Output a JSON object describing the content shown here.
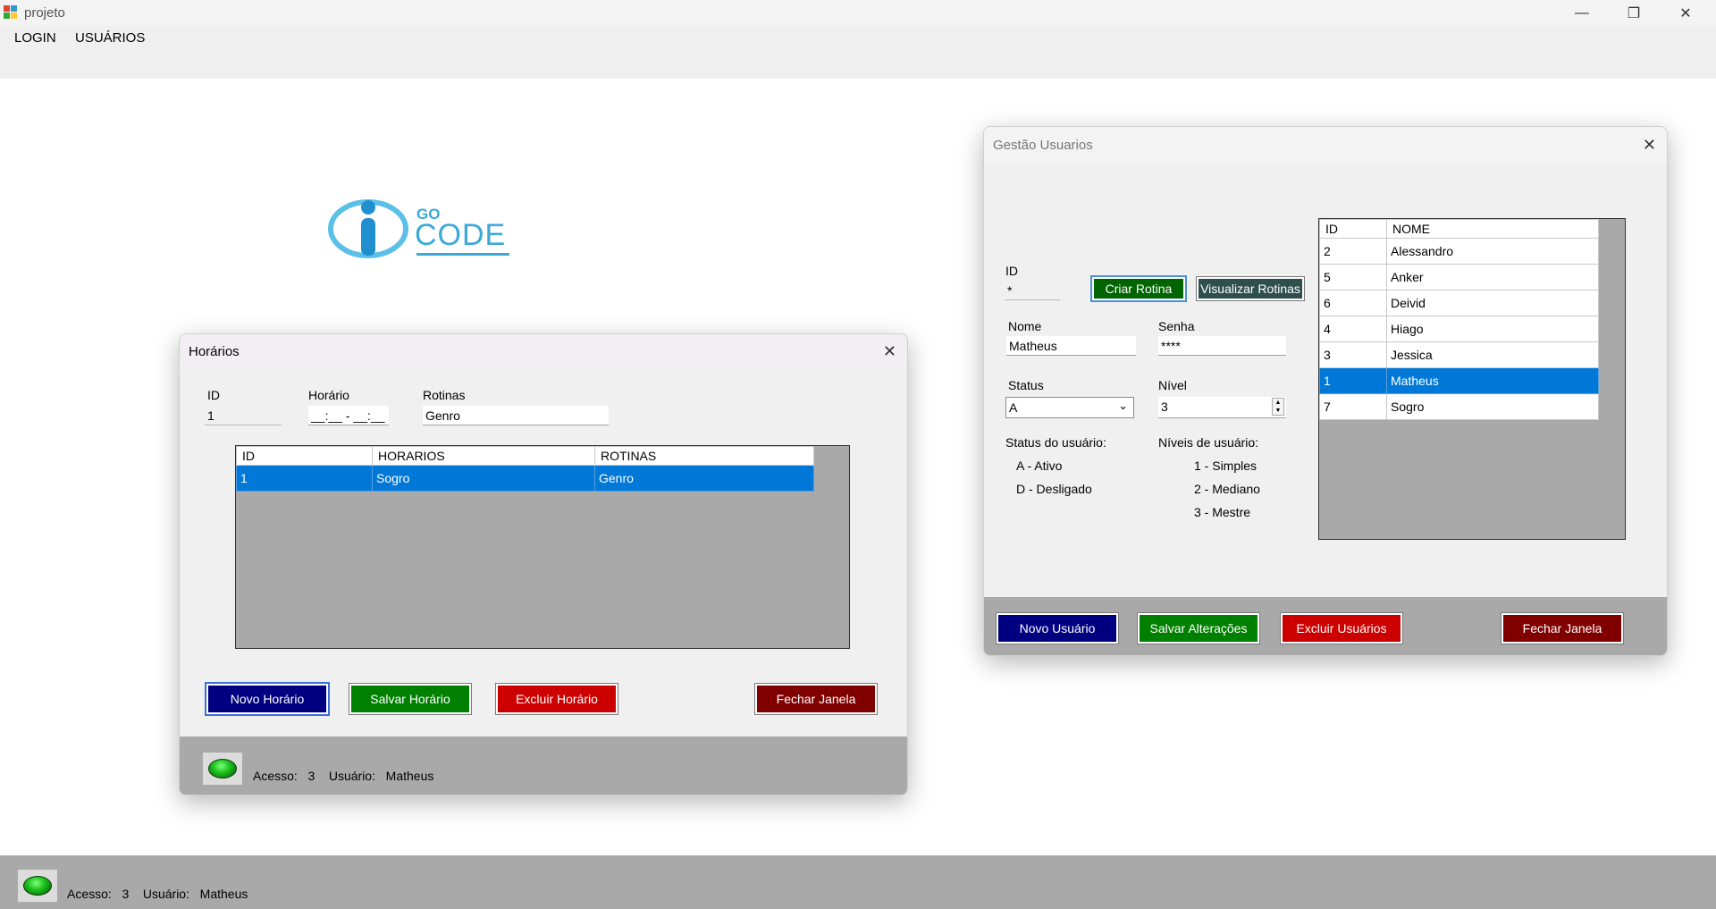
{
  "window": {
    "title": "projeto"
  },
  "menu": {
    "items": [
      "LOGIN",
      "USUÁRIOS"
    ]
  },
  "logo": {
    "small": "GO",
    "big": "CODE"
  },
  "status_main": {
    "access_label": "Acesso:",
    "access_value": "3",
    "user_label": "Usuário:",
    "user_value": "Matheus"
  },
  "horarios": {
    "title": "Horários",
    "id_label": "ID",
    "id_value": "1",
    "horario_label": "Horário",
    "horario_value": "__:__ - __:__",
    "rotinas_label": "Rotinas",
    "rotinas_value": "Genro",
    "grid": {
      "columns": [
        "ID",
        "HORARIOS",
        "ROTINAS"
      ],
      "rows": [
        [
          "1",
          "Sogro",
          "Genro"
        ]
      ]
    },
    "buttons": {
      "novo": "Novo Horário",
      "salvar": "Salvar Horário",
      "excluir": "Excluir Horário",
      "fechar": "Fechar Janela"
    },
    "status": {
      "access_label": "Acesso:",
      "access_value": "3",
      "user_label": "Usuário:",
      "user_value": "Matheus"
    }
  },
  "usuarios": {
    "title": "Gestão Usuarios",
    "id_label": "ID",
    "id_value": "*",
    "criar_rotina": "Criar Rotina",
    "visualizar_rotinas": "Visualizar Rotinas",
    "nome_label": "Nome",
    "nome_value": "Matheus",
    "senha_label": "Senha",
    "senha_value": "****",
    "status_label": "Status",
    "status_value": "A",
    "nivel_label": "Nível",
    "nivel_value": "3",
    "status_help_title": "Status do usuário:",
    "status_help": [
      "A - Ativo",
      "D - Desligado"
    ],
    "nivel_help_title": "Níveis de usuário:",
    "nivel_help": [
      "1 - Simples",
      "2 - Mediano",
      "3 - Mestre"
    ],
    "grid": {
      "columns": [
        "ID",
        "NOME"
      ],
      "rows": [
        [
          "2",
          "Alessandro"
        ],
        [
          "5",
          "Anker"
        ],
        [
          "6",
          "Deivid"
        ],
        [
          "4",
          "Hiago"
        ],
        [
          "3",
          "Jessica"
        ],
        [
          "1",
          "Matheus"
        ],
        [
          "7",
          "Sogro"
        ]
      ],
      "selected_row": 5
    },
    "buttons": {
      "novo": "Novo Usuário",
      "salvar": "Salvar Alterações",
      "excluir": "Excluir Usuários",
      "fechar": "Fechar Janela"
    }
  },
  "colors": {
    "selection": "#0078d7",
    "status_bar": "#a9a9a9",
    "logo_blue": "#3ba9d8"
  }
}
